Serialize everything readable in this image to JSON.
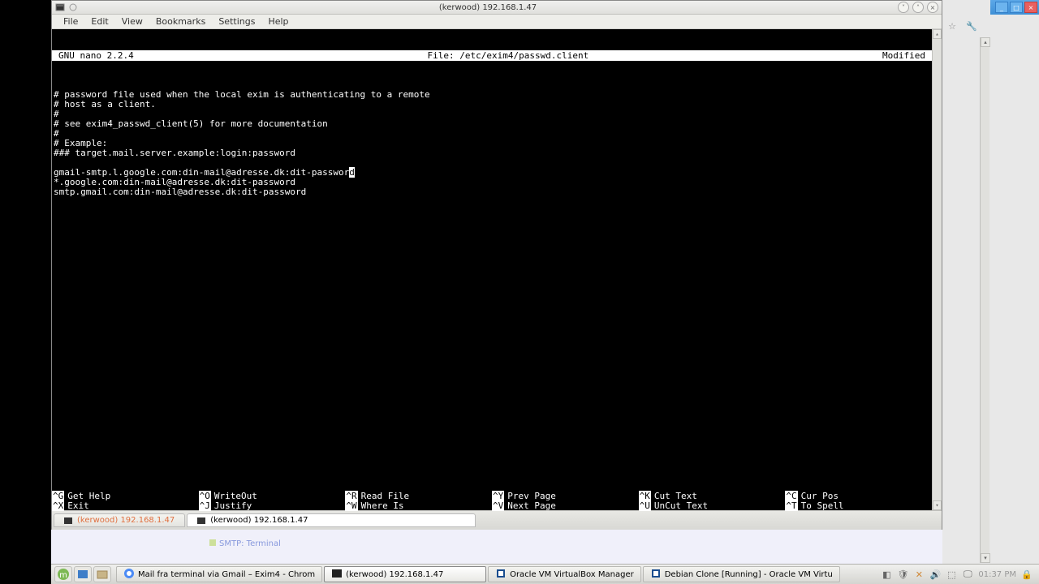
{
  "window": {
    "title": "(kerwood) 192.168.1.47"
  },
  "menubar": {
    "items": [
      "File",
      "Edit",
      "View",
      "Bookmarks",
      "Settings",
      "Help"
    ]
  },
  "nano": {
    "header": {
      "left": "GNU nano 2.2.4",
      "center_prefix": "File: ",
      "file": "/etc/exim4/passwd.client",
      "right": "Modified"
    },
    "lines": [
      "# password file used when the local exim is authenticating to a remote",
      "# host as a client.",
      "#",
      "# see exim4_passwd_client(5) for more documentation",
      "#",
      "# Example:",
      "### target.mail.server.example:login:password",
      "",
      "gmail-smtp.l.google.com:din-mail@adresse.dk:dit-password",
      "*.google.com:din-mail@adresse.dk:dit-password",
      "smtp.gmail.com:din-mail@adresse.dk:dit-password"
    ],
    "cursor_line": 8,
    "footer": [
      {
        "key": "^G",
        "label": "Get Help"
      },
      {
        "key": "^O",
        "label": "WriteOut"
      },
      {
        "key": "^R",
        "label": "Read File"
      },
      {
        "key": "^Y",
        "label": "Prev Page"
      },
      {
        "key": "^K",
        "label": "Cut Text"
      },
      {
        "key": "^C",
        "label": "Cur Pos"
      },
      {
        "key": "^X",
        "label": "Exit"
      },
      {
        "key": "^J",
        "label": "Justify"
      },
      {
        "key": "^W",
        "label": "Where Is"
      },
      {
        "key": "^V",
        "label": "Next Page"
      },
      {
        "key": "^U",
        "label": "UnCut Text"
      },
      {
        "key": "^T",
        "label": "To Spell"
      }
    ]
  },
  "tabs": [
    {
      "label": "(kerwood) 192.168.1.47",
      "active": false,
      "dimmed": true
    },
    {
      "label": "(kerwood) 192.168.1.47",
      "active": true,
      "dimmed": false
    }
  ],
  "bg_link": "SMTP: Terminal",
  "taskbar": {
    "items": [
      {
        "label": "Mail fra terminal via Gmail – Exim4 - Chrom",
        "icon": "chrome",
        "active": false
      },
      {
        "label": "(kerwood) 192.168.1.47",
        "icon": "terminal",
        "active": true
      },
      {
        "label": "Oracle VM VirtualBox Manager",
        "icon": "virtualbox",
        "active": false
      },
      {
        "label": "Debian Clone [Running] - Oracle VM Virtu",
        "icon": "virtualbox",
        "active": false
      }
    ],
    "clock": "01:37 PM"
  }
}
